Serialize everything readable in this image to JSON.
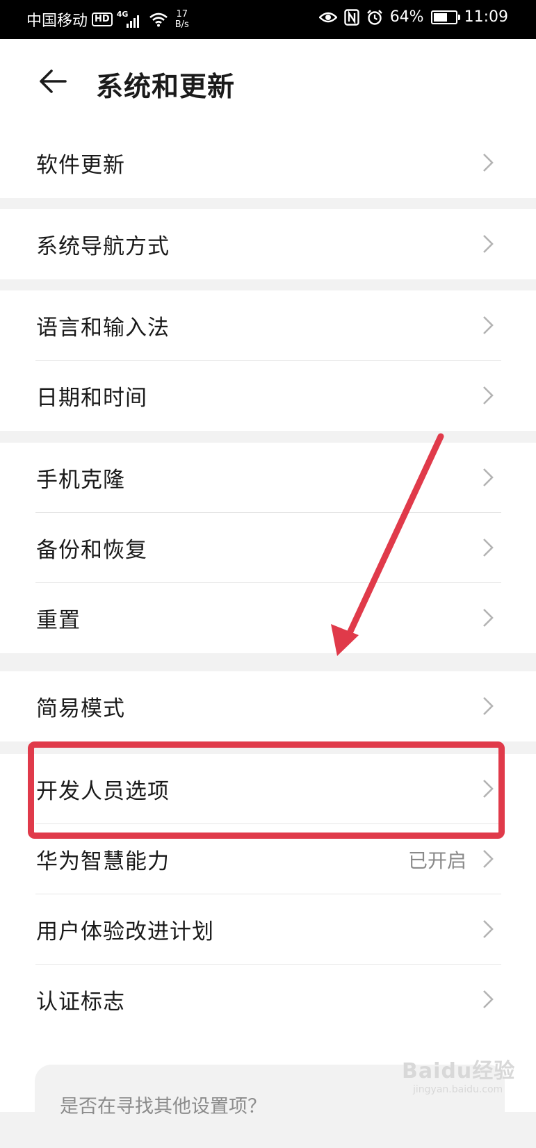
{
  "status_bar": {
    "carrier": "中国移动",
    "hd_badge": "HD",
    "network": "4G",
    "speed_value": "17",
    "speed_unit": "B/s",
    "battery_percent": "64%",
    "battery_level": 0.64,
    "time": "11:09"
  },
  "header": {
    "title": "系统和更新"
  },
  "groups": [
    {
      "items": [
        {
          "label": "软件更新"
        }
      ]
    },
    {
      "items": [
        {
          "label": "系统导航方式"
        }
      ]
    },
    {
      "items": [
        {
          "label": "语言和输入法"
        },
        {
          "label": "日期和时间"
        }
      ]
    },
    {
      "items": [
        {
          "label": "手机克隆"
        },
        {
          "label": "备份和恢复"
        },
        {
          "label": "重置"
        }
      ]
    },
    {
      "items": [
        {
          "label": "简易模式"
        }
      ]
    },
    {
      "items": [
        {
          "label": "开发人员选项"
        },
        {
          "label": "华为智慧能力",
          "value": "已开启"
        },
        {
          "label": "用户体验改进计划"
        },
        {
          "label": "认证标志"
        }
      ]
    }
  ],
  "search_card": {
    "question": "是否在寻找其他设置项？"
  },
  "annotation": {
    "color": "#e03a4a"
  },
  "watermark": {
    "text": "Baidu经验",
    "sub": "jingyan.baidu.com"
  }
}
